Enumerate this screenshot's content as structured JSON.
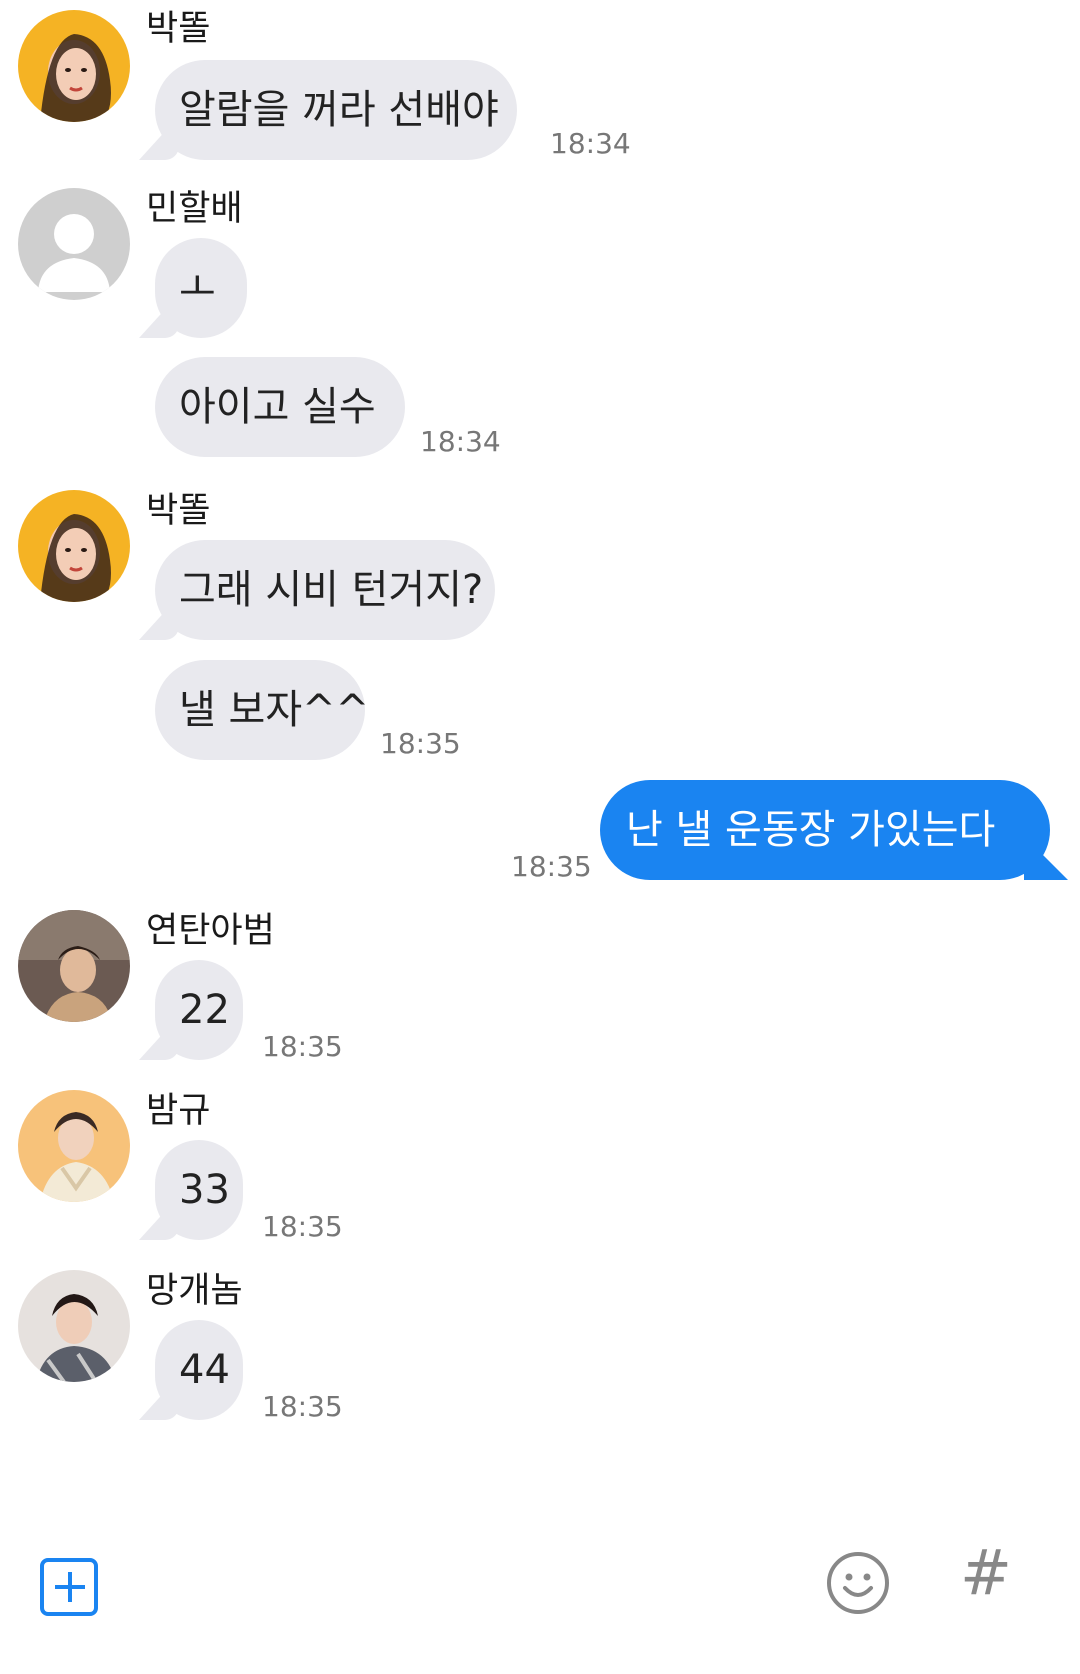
{
  "messages": [
    {
      "sender": "박똘",
      "lines": [
        "알람을 꺼라 선배야"
      ],
      "time": "18:34"
    },
    {
      "sender": "민할배",
      "lines": [
        "ㅗ",
        "아이고 실수"
      ],
      "time": "18:34"
    },
    {
      "sender": "박똘",
      "lines": [
        "그래 시비 턴거지?",
        "낼 보자^^"
      ],
      "time": "18:35"
    },
    {
      "sender": "",
      "mine": "난 낼 운동장 가있는다",
      "time": "18:35"
    },
    {
      "sender": "연탄아범",
      "lines": [
        "22"
      ],
      "time": "18:35"
    },
    {
      "sender": "밤규",
      "lines": [
        "33"
      ],
      "time": "18:35"
    },
    {
      "sender": "망개놈",
      "lines": [
        "44"
      ],
      "time": "18:35"
    }
  ],
  "toolbar": {
    "add_icon": "plus-square-icon",
    "emoji_icon": "smiley-icon",
    "hash_label": "#"
  },
  "colors": {
    "incoming_bubble": "#e9e9ee",
    "outgoing_bubble": "#1a84f1",
    "accent": "#1a84f1"
  }
}
